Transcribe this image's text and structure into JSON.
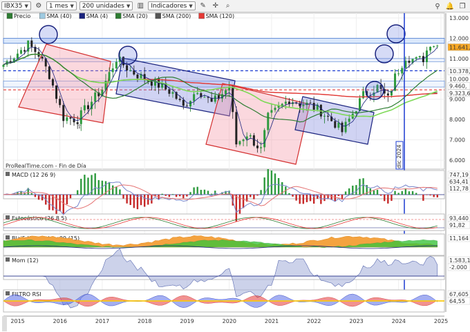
{
  "toolbar": {
    "symbol": "IBX35",
    "period": "1 mes",
    "units": "200 unidades",
    "indicators": "Indicadores"
  },
  "watermark": "ProRealTime.com - Fin de Día",
  "legend": [
    {
      "label": "Precio",
      "color": "#2e7d32"
    },
    {
      "label": "SMA (40)",
      "color": "#9ecae1"
    },
    {
      "label": "SMA (4)",
      "color": "#1a237e"
    },
    {
      "label": "SMA (20)",
      "color": "#2e7d32"
    },
    {
      "label": "SMA (200)",
      "color": "#555555"
    },
    {
      "label": "SMA (120)",
      "color": "#e53935"
    }
  ],
  "price_axis": {
    "ticks": [
      "13.000",
      "12.000",
      "11.000",
      "10.000",
      "9.000",
      "8.000",
      "7.000",
      "6.000"
    ],
    "badges": [
      {
        "text": "11.648,2",
        "bg": "#ffffff",
        "fg": "#222222",
        "y": 11648
      },
      {
        "text": "11.641,3",
        "bg": "#f9a825",
        "fg": "#222222",
        "y": 11560
      },
      {
        "text": "10.378,4",
        "bg": "#ffffff",
        "fg": "#2e7d32",
        "y": 10378
      },
      {
        "text": "9.460,",
        "bg": "#ffffff",
        "fg": "#e53935",
        "y": 9650
      },
      {
        "text": "9.323,6",
        "bg": "#ffffff",
        "fg": "#2e7d32",
        "y": 9300
      }
    ]
  },
  "time_axis": [
    "2015",
    "2016",
    "2017",
    "2018",
    "2019",
    "2020",
    "2021",
    "2022",
    "2023",
    "2024",
    "2025"
  ],
  "date_tag": "dic 2024",
  "panels": [
    {
      "title": "MACD (12 26 9)",
      "values": [
        "747,19",
        "634,41",
        "112,78"
      ]
    },
    {
      "title": "Estocástico (26 8 5)",
      "values": [
        "93,440",
        "91,82"
      ]
    },
    {
      "title": "Blai5 Koncorde v.09 (15)",
      "values": [
        "11,164"
      ]
    },
    {
      "title": "Mom (12)",
      "values": [
        "1.583,1",
        "-2.000"
      ]
    },
    {
      "title": "FILTRO RSI",
      "values": [
        "67,605",
        "64,55"
      ]
    }
  ],
  "chart_data": {
    "type": "line",
    "title": "IBX35",
    "x_range": [
      "2014-09",
      "2025-01"
    ],
    "ylim": [
      5600,
      13200
    ],
    "close_anchors": [
      [
        "2014-09",
        10700
      ],
      [
        "2015-04",
        11700
      ],
      [
        "2015-07",
        11200
      ],
      [
        "2015-10",
        10200
      ],
      [
        "2016-02",
        8100
      ],
      [
        "2016-06",
        8000
      ],
      [
        "2016-09",
        8700
      ],
      [
        "2017-01",
        9500
      ],
      [
        "2017-05",
        11000
      ],
      [
        "2017-09",
        10400
      ],
      [
        "2017-12",
        10100
      ],
      [
        "2018-04",
        9800
      ],
      [
        "2018-09",
        9300
      ],
      [
        "2018-12",
        8600
      ],
      [
        "2019-04",
        9500
      ],
      [
        "2019-08",
        8800
      ],
      [
        "2020-01",
        9600
      ],
      [
        "2020-03",
        6800
      ],
      [
        "2020-06",
        7300
      ],
      [
        "2020-10",
        6500
      ],
      [
        "2020-12",
        8100
      ],
      [
        "2021-06",
        9000
      ],
      [
        "2021-09",
        8800
      ],
      [
        "2021-12",
        8700
      ],
      [
        "2022-03",
        8400
      ],
      [
        "2022-07",
        7800
      ],
      [
        "2022-09",
        7400
      ],
      [
        "2022-12",
        8300
      ],
      [
        "2023-03",
        9200
      ],
      [
        "2023-07",
        9600
      ],
      [
        "2023-10",
        9000
      ],
      [
        "2023-12",
        10100
      ],
      [
        "2024-03",
        11100
      ],
      [
        "2024-06",
        10900
      ],
      [
        "2024-08",
        11000
      ],
      [
        "2024-10",
        11800
      ],
      [
        "2024-12",
        11640
      ]
    ],
    "levels": {
      "resistance": 11900,
      "support_dashed_blue": 10400,
      "support_dashed_red": 9460
    }
  }
}
